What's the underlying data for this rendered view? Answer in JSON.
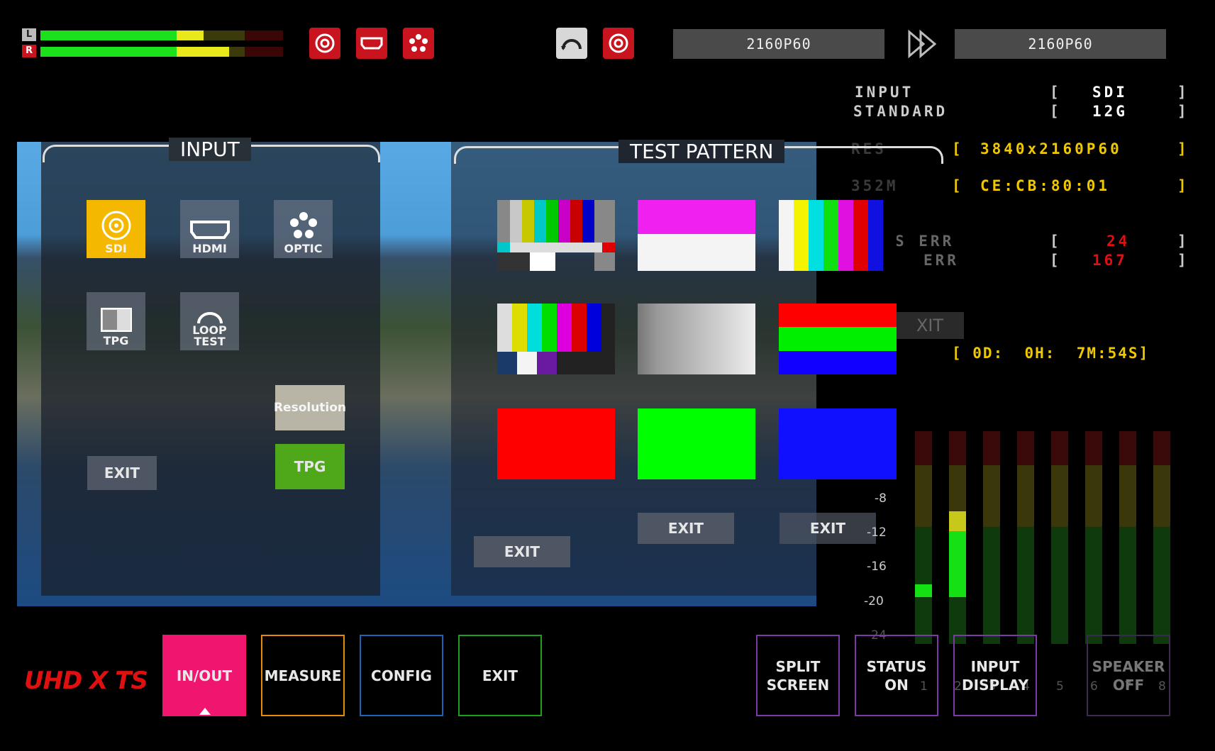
{
  "top": {
    "l_tag": "L",
    "r_tag": "R",
    "format_in": "2160P60",
    "format_out": "2160P60"
  },
  "status": {
    "input_label": "INPUT",
    "standard_label": "STANDARD",
    "input_value": "SDI",
    "standard_value": "12G",
    "resolution_value": "3840x2160P60",
    "st352m_value": "CE:CB:80:01",
    "crc_err": "24",
    "edh_err": "167",
    "elapsed": "[ 0D:  0H:  7M:54S]",
    "partial_label_1": "RES",
    "partial_label_2": "352M",
    "partial_err_1": "S ERR",
    "partial_err_2": "ERR",
    "partial_exit": "XIT"
  },
  "input_panel": {
    "title": "INPUT",
    "tiles": [
      "SDI",
      "HDMI",
      "OPTIC",
      "TPG",
      "LOOP\nTEST"
    ],
    "resolution_btn": "Resolution",
    "tpg_btn": "TPG",
    "exit": "EXIT"
  },
  "test_pattern_panel": {
    "title": "TEST PATTERN",
    "exit_1": "EXIT",
    "exit_2": "EXIT",
    "exit_3": "EXIT"
  },
  "meter": {
    "scale": [
      "-8",
      "-12",
      "-16",
      "-20",
      "-24"
    ],
    "channels": [
      "1",
      "2",
      "3",
      "4",
      "5",
      "6",
      "7",
      "8"
    ],
    "levels": [
      0.12,
      0.62,
      0,
      0,
      0,
      0,
      0,
      0
    ]
  },
  "bottom_menu": {
    "logo": "UHD X TS",
    "in_out": "IN/OUT",
    "measure": "MEASURE",
    "config": "CONFIG",
    "exit": "EXIT",
    "split_screen": "SPLIT\nSCREEN",
    "status_on": "STATUS\nON",
    "input_display": "INPUT\nDISPLAY",
    "speaker_off": "SPEAKER\nOFF"
  },
  "colors": {
    "accent_red": "#c8141e",
    "in_out_pink": "#f0156e",
    "sdi_yellow": "#f5b800",
    "status_yellow": "#f0c800",
    "err_red": "#e01010",
    "tpg_green": "#4fa81a"
  }
}
